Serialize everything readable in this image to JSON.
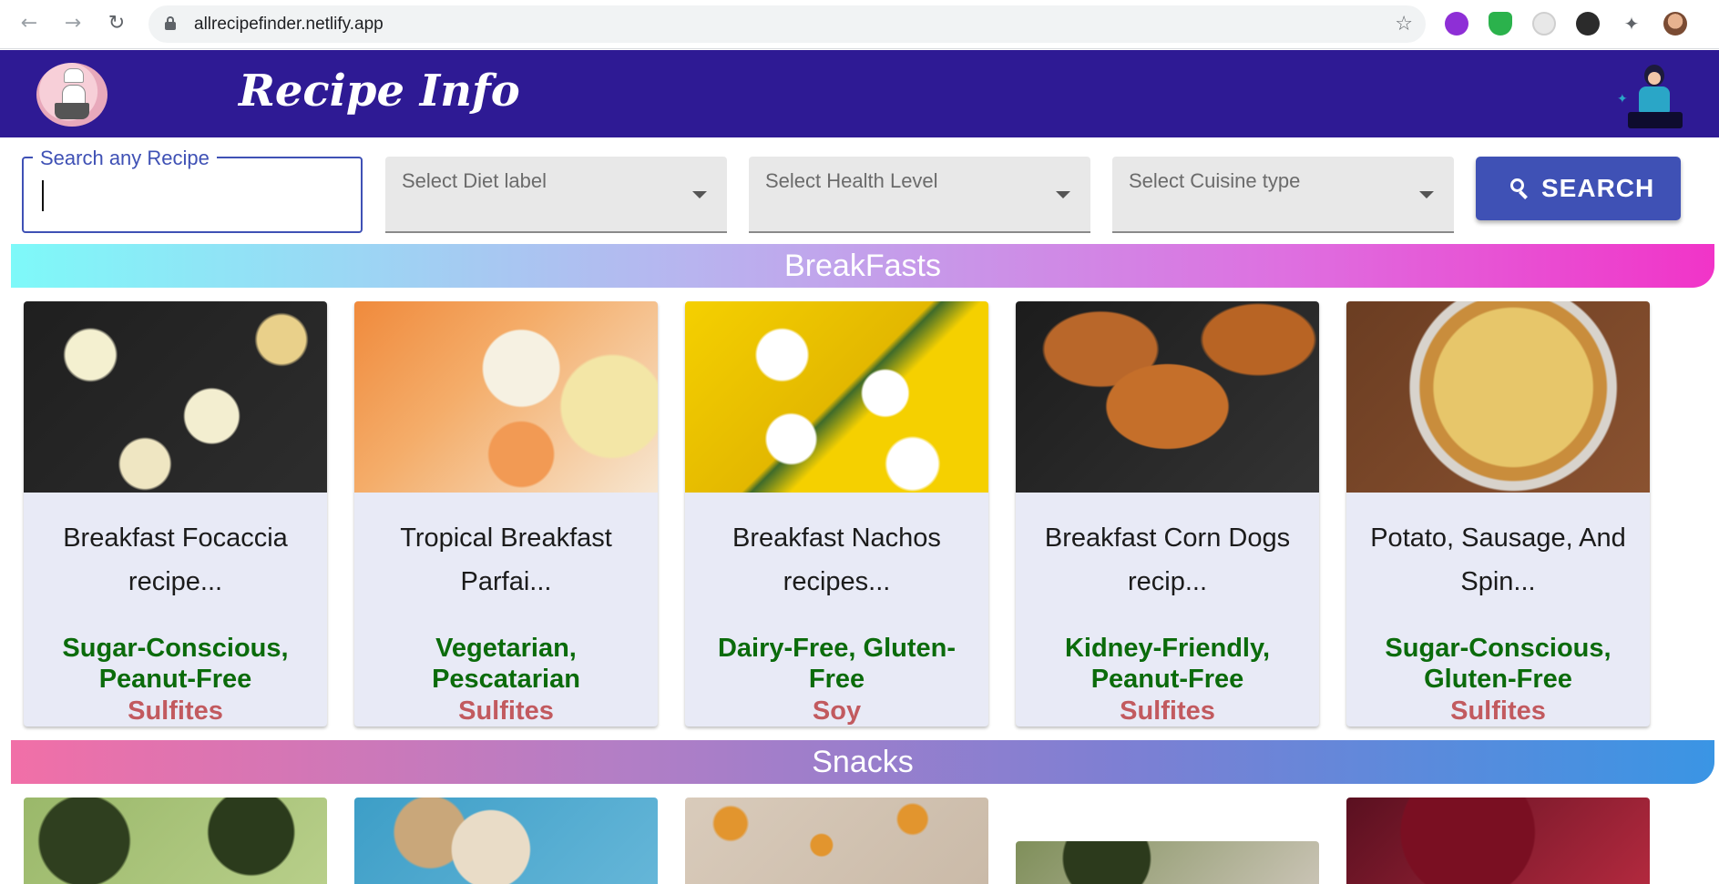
{
  "browser": {
    "url": "allrecipefinder.netlify.app",
    "back_icon": "arrow-left-icon",
    "forward_icon": "arrow-right-icon",
    "reload_icon": "reload-icon",
    "star_icon": "star-icon",
    "extensions": [
      "purple-face-extension",
      "green-shield-extension",
      "clock-extension",
      "vd-extension",
      "puzzle-icon",
      "profile-avatar"
    ]
  },
  "header": {
    "brand": "Recipe Info",
    "logo_icon": "chef-logo-icon",
    "illustration": "cooking-woman-illustration",
    "background": "#2e1a94"
  },
  "search": {
    "label": "Search any Recipe",
    "value": "",
    "diet_placeholder": "Select Diet label",
    "health_placeholder": "Select Health Level",
    "cuisine_placeholder": "Select Cuisine type",
    "button_label": "SEARCH",
    "button_icon": "search-icon",
    "accent": "#3f51b5"
  },
  "sections": {
    "breakfast": {
      "title": "BreakFasts",
      "cards": [
        {
          "title": "Breakfast Focaccia recipe...",
          "diet": "Sugar-Conscious, Peanut-Free",
          "caution": "Sulfites"
        },
        {
          "title": "Tropical Breakfast Parfai...",
          "diet": "Vegetarian, Pescatarian",
          "caution": "Sulfites"
        },
        {
          "title": "Breakfast Nachos recipes...",
          "diet": "Dairy-Free, Gluten-Free",
          "caution": "Soy"
        },
        {
          "title": "Breakfast Corn Dogs recip...",
          "diet": "Kidney-Friendly, Peanut-Free",
          "caution": "Sulfites"
        },
        {
          "title": "Potato, Sausage, And Spin...",
          "diet": "Sugar-Conscious, Gluten-Free",
          "caution": "Sulfites"
        }
      ]
    },
    "snacks": {
      "title": "Snacks"
    }
  },
  "colors": {
    "diet_text": "#0b6b0b",
    "caution_text": "#c25a5f",
    "card_bg": "#e8eaf6"
  }
}
